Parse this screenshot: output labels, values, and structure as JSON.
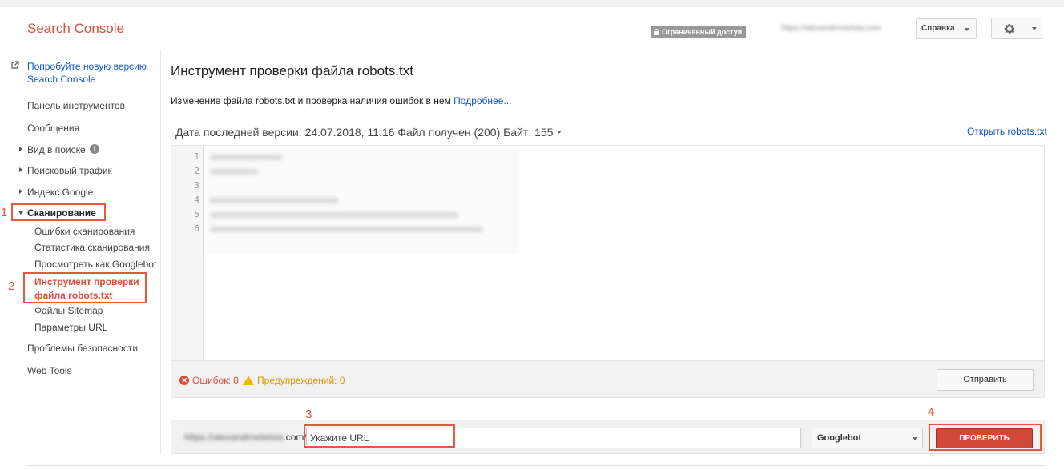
{
  "header": {
    "logo": "Search Console",
    "restricted_label": "Ограниченный доступ",
    "site_url": "https://alexandrnetelsia.com",
    "help_label": "Справка"
  },
  "sidebar": {
    "new_version_link": "Попробуйте новую версию Search Console",
    "items": [
      "Панель инструментов",
      "Сообщения",
      "Вид в поиске",
      "Поисковый трафик",
      "Индекс Google",
      "Сканирование",
      "Проблемы безопасности",
      "Web Tools"
    ],
    "crawl_subitems": [
      "Ошибки сканирования",
      "Статистика сканирования",
      "Просмотреть как Googlebot",
      "Инструмент проверки файла robots.txt",
      "Файлы Sitemap",
      "Параметры URL"
    ]
  },
  "annotations": {
    "n1": "1",
    "n2": "2",
    "n3": "3",
    "n4": "4"
  },
  "main": {
    "title": "Инструмент проверки файла robots.txt",
    "description": "Изменение файла robots.txt и проверка наличия ошибок в нем",
    "more_link": "Подробнее...",
    "version_info": "Дата последней версии: 24.07.2018, 11:16 Файл получен (200) Байт: 155",
    "open_robots_link": "Открыть robots.txt",
    "line_numbers": [
      "1",
      "2",
      "3",
      "4",
      "5",
      "6"
    ],
    "errors_label": "Ошибок: 0",
    "warnings_label": "Предупреждений: 0",
    "submit_label": "Отправить",
    "domain_prefix": "https://alexandrnetelsia",
    "domain_suffix": ".com/",
    "url_placeholder": "Укажите URL",
    "bot_selected": "Googlebot",
    "check_label": "ПРОВЕРИТЬ"
  },
  "colors": {
    "accent": "#dd4b39",
    "link": "#1155cc",
    "annotation": "#e8573e",
    "warning": "#e69300"
  }
}
